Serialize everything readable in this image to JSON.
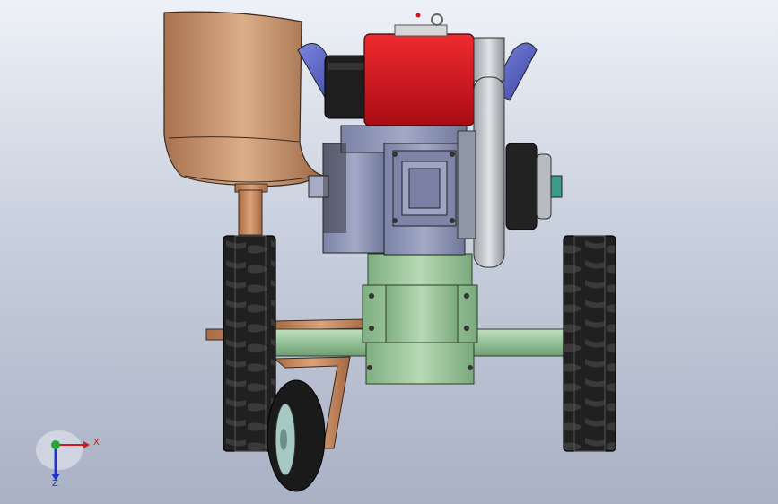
{
  "viewport": {
    "background_top": "#eef1f7",
    "background_bottom": "#a9b1c4"
  },
  "colors": {
    "fuel_tank": "#d0121c",
    "engine_block": "#8e95b7",
    "gearbox": "#9cc79c",
    "tires": "#1e1e1e",
    "seat": "#d2a27a",
    "handles": "#5a66c8",
    "flywheel": "#c9cdd2",
    "axle": "#95c49a",
    "frame": "#c98a5e"
  },
  "triad": {
    "x_label": "X",
    "z_label": "Z",
    "x_color": "#d11b1b",
    "z_color": "#2233cc",
    "y_color": "#22aa33"
  }
}
